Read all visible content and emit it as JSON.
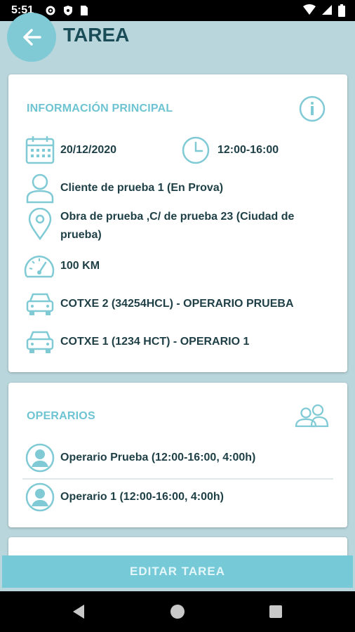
{
  "status_bar": {
    "time": "5:51"
  },
  "header": {
    "title": "TAREA"
  },
  "info_section": {
    "title": "INFORMACIÓN PRINCIPAL",
    "date": "20/12/2020",
    "time_range": "12:00-16:00",
    "client": "Cliente de prueba 1 (En Prova)",
    "address_line1": "Obra de prueba ,C/ de prueba 23 (Ciudad de",
    "address_line2": "prueba)",
    "distance": "100 KM",
    "vehicle1": "COTXE 2 (34254HCL) - OPERARIO PRUEBA",
    "vehicle2": "COTXE 1 (1234 HCT) - OPERARIO 1"
  },
  "operarios_section": {
    "title": "OPERARIOS",
    "items": [
      {
        "label": "Operario Prueba (12:00-16:00, 4:00h)"
      },
      {
        "label": "Operario 1 (12:00-16:00, 4:00h)"
      }
    ]
  },
  "footer": {
    "edit_button": "EDITAR TAREA"
  },
  "colors": {
    "accent": "#7fcad5",
    "title": "#1a4d57",
    "section": "#6ec4d2",
    "background": "#b9d6dc"
  }
}
